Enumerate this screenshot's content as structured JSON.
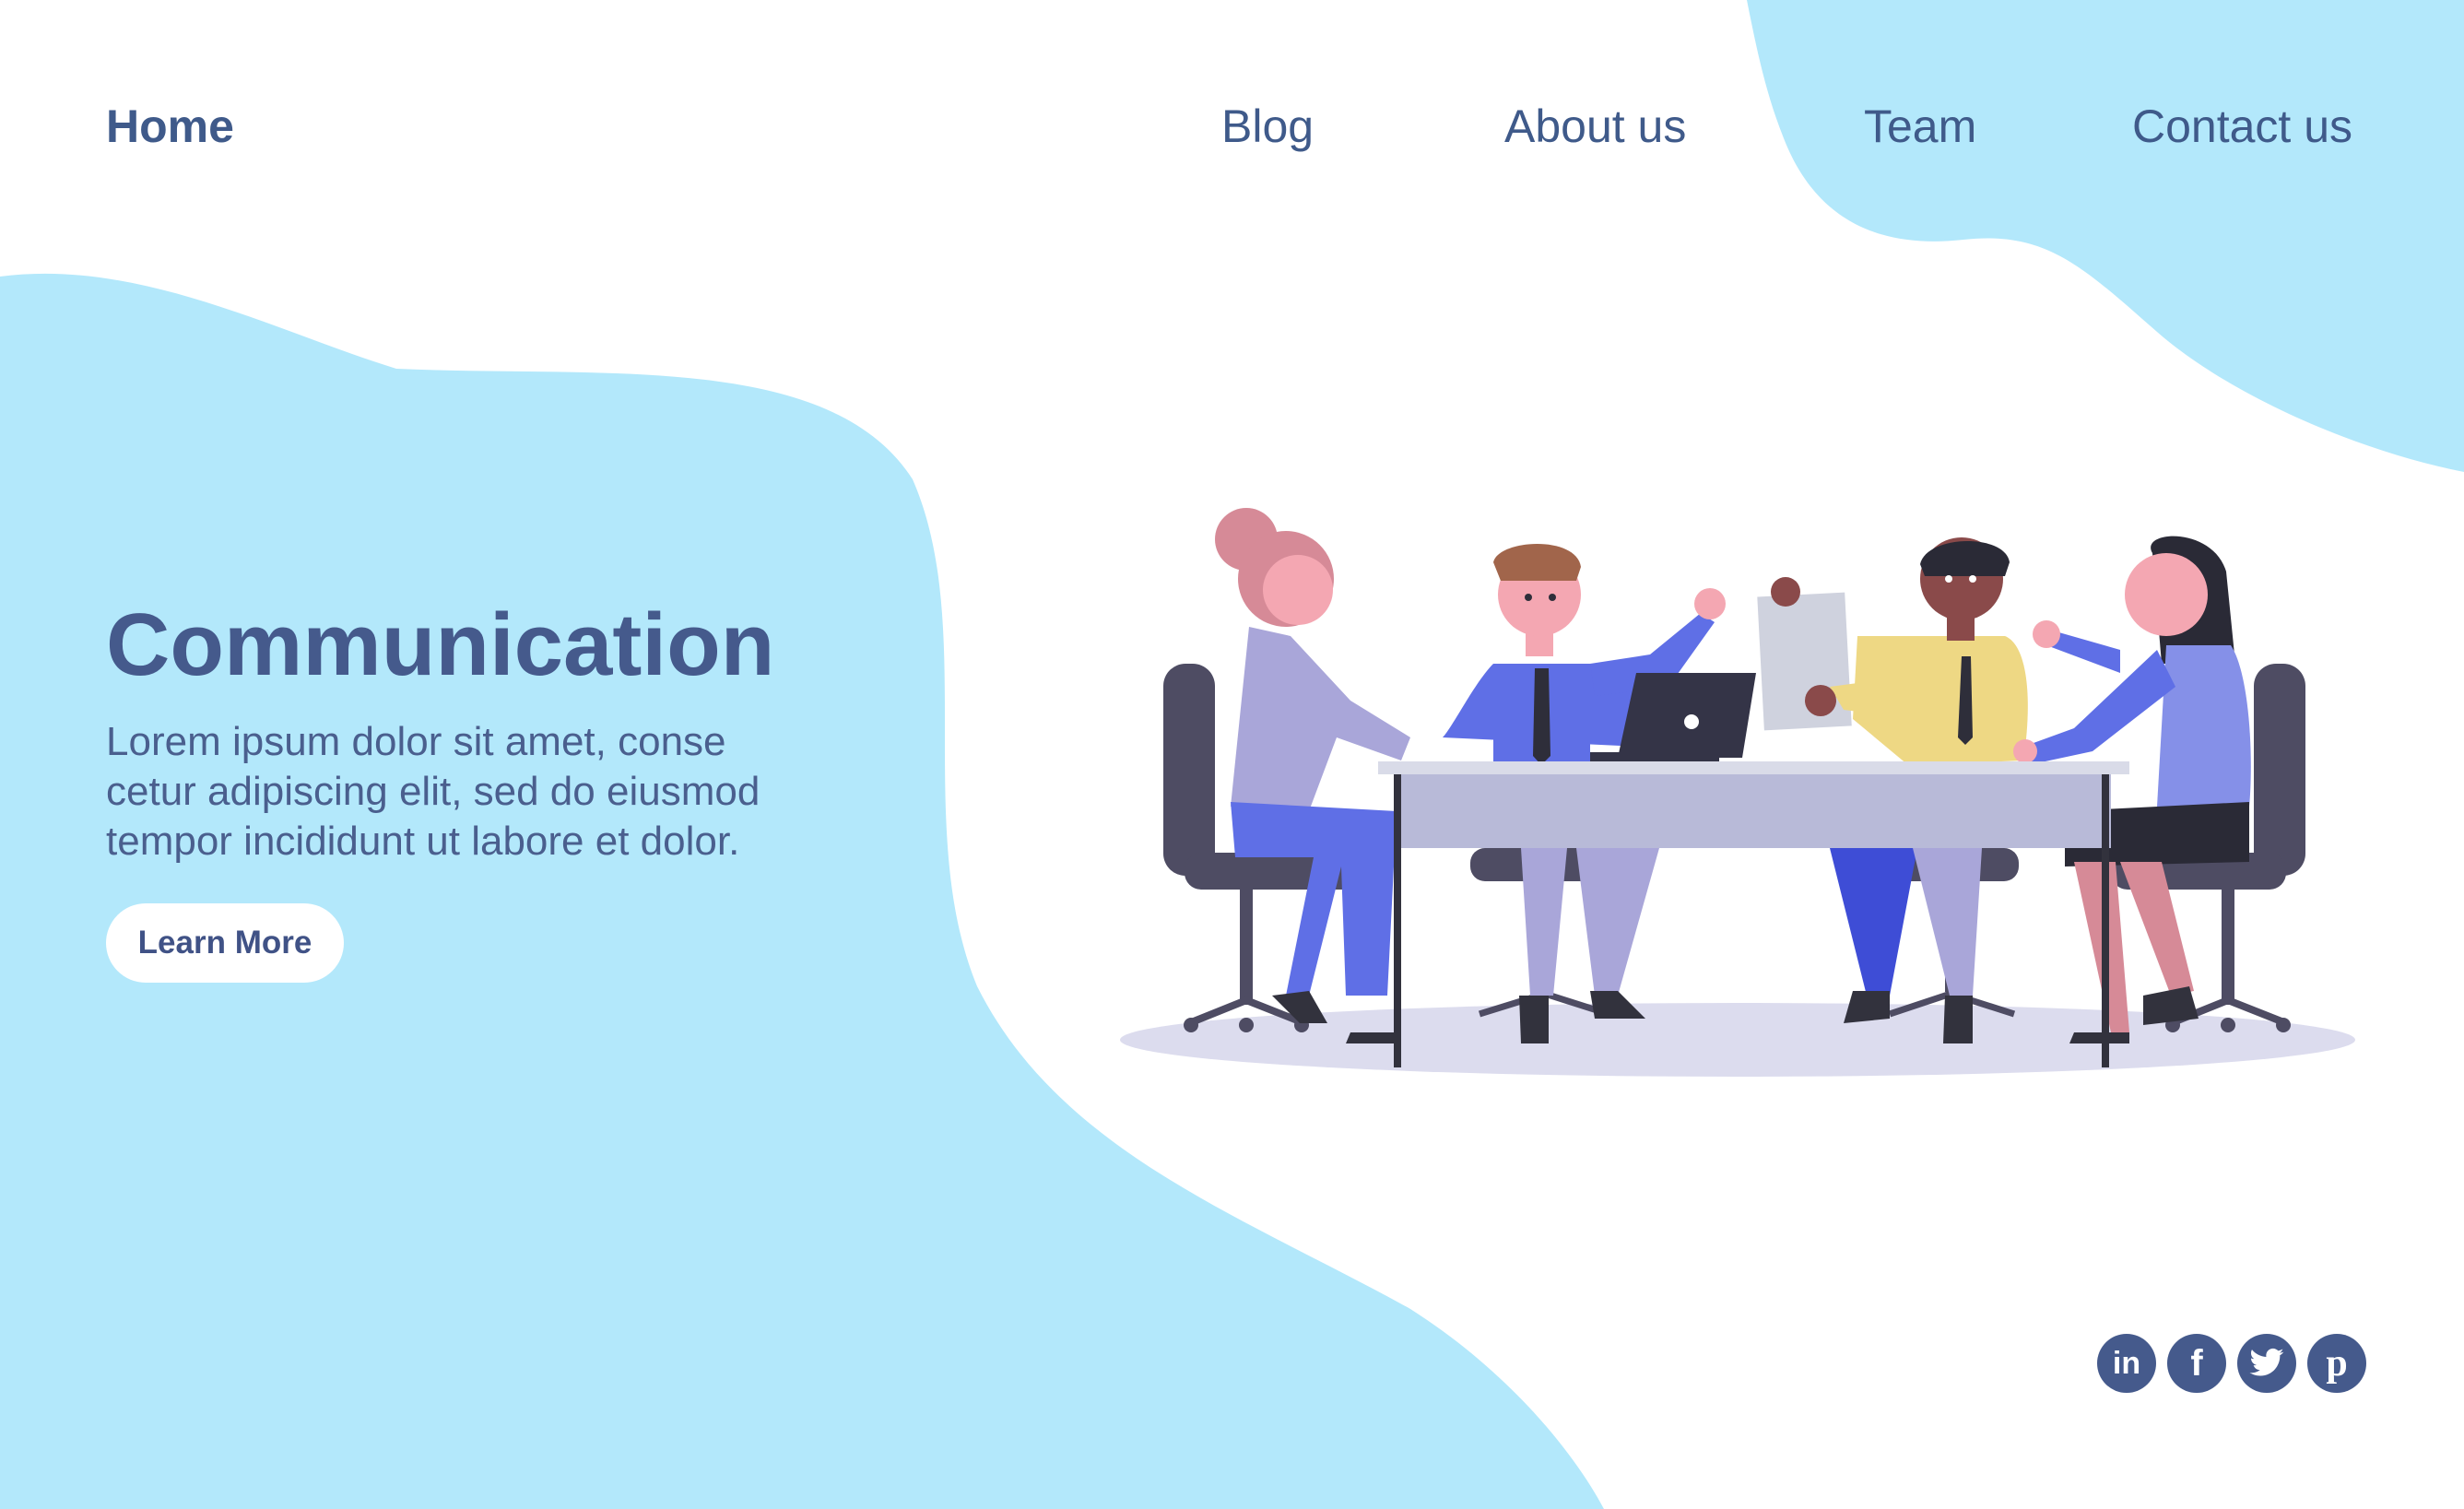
{
  "nav": {
    "home": "Home",
    "blog": "Blog",
    "about": "About us",
    "team": "Team",
    "contact": "Contact us"
  },
  "hero": {
    "title": "Communication",
    "body_lines": [
      "Lorem ipsum dolor sit amet, conse",
      "cetur adipiscing elit, sed do eiusmod",
      "tempor incididunt ut labore et dolor."
    ],
    "cta": "Learn More"
  },
  "socials": [
    {
      "icon": "linkedin-icon",
      "glyph": "in"
    },
    {
      "icon": "facebook-icon",
      "glyph": "f"
    },
    {
      "icon": "twitter-icon"
    },
    {
      "icon": "pinterest-icon",
      "glyph": "p"
    }
  ],
  "colors": {
    "accent_blue": "#b3e8fb",
    "text_navy": "#455a8c",
    "background": "#ffffff"
  }
}
